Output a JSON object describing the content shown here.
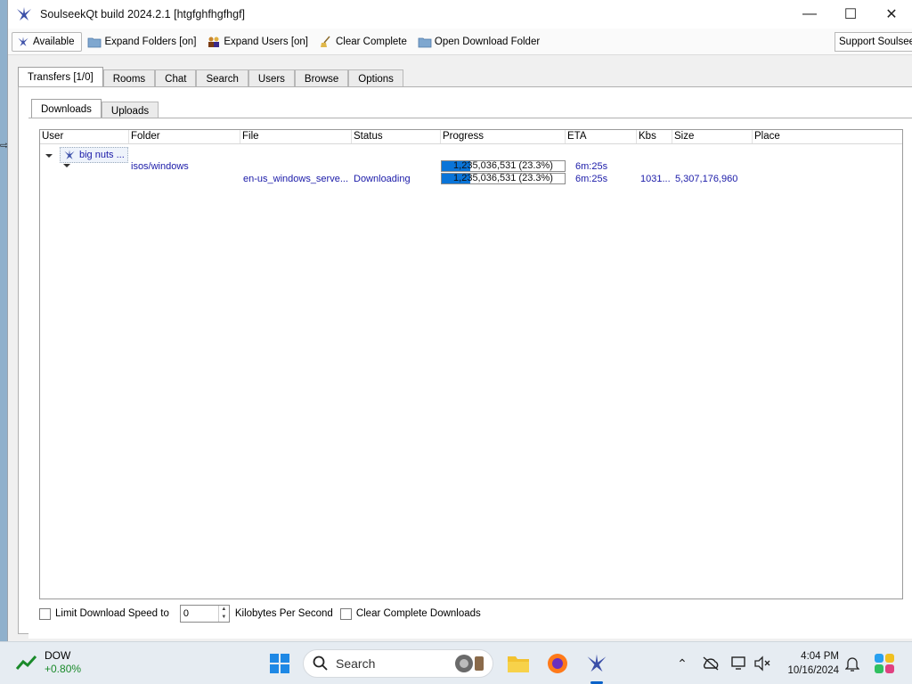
{
  "window": {
    "title": "SoulseekQt build 2024.2.1 [htgfghfhgfhgf]"
  },
  "toolbar": {
    "available": "Available",
    "expand_folders": "Expand Folders [on]",
    "expand_users": "Expand Users [on]",
    "clear_complete": "Clear Complete",
    "open_download_folder": "Open Download Folder",
    "support": "Support Soulseek"
  },
  "main_tabs": [
    "Transfers [1/0]",
    "Rooms",
    "Chat",
    "Search",
    "Users",
    "Browse",
    "Options"
  ],
  "sub_tabs": [
    "Downloads",
    "Uploads"
  ],
  "columns": [
    "User",
    "Folder",
    "File",
    "Status",
    "Progress",
    "ETA",
    "Kbs",
    "Size",
    "Place"
  ],
  "tree": {
    "user": "big nuts ...",
    "folder": {
      "name": "isos/windows",
      "progress_text": "1,235,036,531 (23.3%)",
      "progress_fraction": 0.233,
      "eta": "6m:25s"
    },
    "file": {
      "name": "en-us_windows_serve...",
      "status": "Downloading",
      "progress_text": "1,235,036,531 (23.3%)",
      "progress_fraction": 0.233,
      "eta": "6m:25s",
      "kbs": "1031...",
      "size": "5,307,176,960",
      "place": ""
    }
  },
  "bottom": {
    "limit_label": "Limit Download Speed to",
    "limit_value": "0",
    "limit_unit": "Kilobytes Per Second",
    "clear_label": "Clear Complete Downloads"
  },
  "taskbar": {
    "stock_name": "DOW",
    "stock_change": "+0.80%",
    "search_placeholder": "Search",
    "time": "4:04 PM",
    "date": "10/16/2024"
  },
  "colors": {
    "accent": "#0a74d8",
    "link_text": "#1a1aa8",
    "stock_up": "#1a8a2a"
  }
}
